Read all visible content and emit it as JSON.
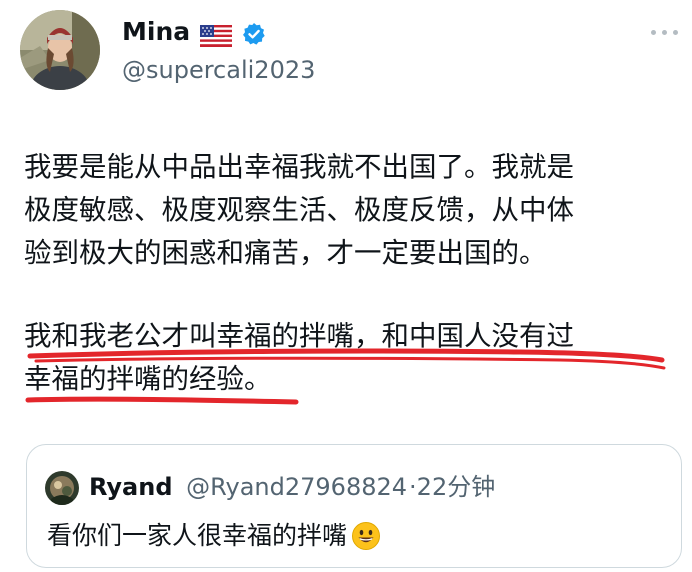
{
  "author": {
    "display_name": "Mina",
    "flag": "us-flag-icon",
    "verified": "verified-badge-icon",
    "handle": "@supercali2023"
  },
  "tweet": {
    "lines": [
      "我要是能从中品出幸福我就不出国了。我就是",
      "极度敏感、极度观察生活、极度反馈，从中体",
      "验到极大的困惑和痛苦，才一定要出国的。",
      "我和我老公才叫幸福的拌嘴，和中国人没有过",
      "幸福的拌嘴的经验。"
    ],
    "underline_color": "#e3262b"
  },
  "quoted_tweet": {
    "display_name": "Ryand",
    "handle": "@Ryand27968824",
    "separator": "·",
    "time": "22分钟",
    "text": "看你们一家人很幸福的拌嘴",
    "emoji": "grinning-face-emoji"
  },
  "colors": {
    "text": "#0f1419",
    "secondary": "#536471",
    "verified": "#1d9bf0",
    "border": "#cfd9de"
  }
}
